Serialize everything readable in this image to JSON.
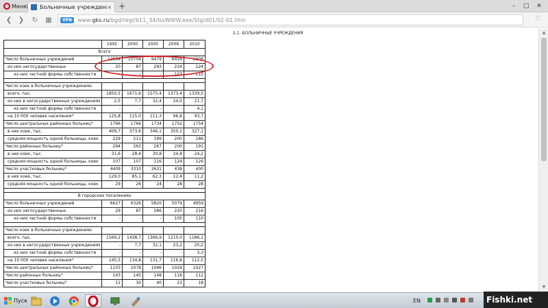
{
  "browser": {
    "menu_label": "Меню",
    "tab_title": "Больничные учреждения",
    "tab_close": "×",
    "newtab": "+",
    "win_min": "–",
    "win_max": "□",
    "win_close": "✕",
    "vpn_label": "VPN",
    "url_prefix": "www.",
    "url_host": "gks.ru",
    "url_path": "/bgd/regl/b11_34/IssWWW.exe/Stg/d01/02-01.htm"
  },
  "page": {
    "heading": "2.1. БОЛЬНИЧНЫЕ УЧРЕЖДЕНИЯ",
    "years": [
      "1995",
      "2000",
      "2005",
      "2009",
      "2010"
    ]
  },
  "rows": [
    {
      "section": "Всего"
    },
    {
      "label": "Число больничных учреждений",
      "indent": 0,
      "values": [
        "12064",
        "10704",
        "9479",
        "6454",
        "6308"
      ]
    },
    {
      "label": "из них негосударственных",
      "indent": 1,
      "values": [
        "20",
        "87",
        "293",
        "224",
        "224"
      ]
    },
    {
      "label": "из них частной формы собственности",
      "indent": 2,
      "values": [
        "-",
        "-",
        "-",
        "107",
        "115"
      ]
    },
    {
      "blank": true
    },
    {
      "label": "Число коек в больничных учреждениях:",
      "indent": 0,
      "values": [
        "",
        "",
        "",
        "",
        ""
      ]
    },
    {
      "label": "всего, тыс.",
      "indent": 1,
      "values": [
        "1850,5",
        "1671,6",
        "1575,4",
        "1373,4",
        "1339,5"
      ]
    },
    {
      "label": "из них в негосударственных учреждениях",
      "indent": 1,
      "values": [
        "2,5",
        "7,7",
        "32,4",
        "24,0",
        "21,7"
      ]
    },
    {
      "label": "из них частной формы собственности",
      "indent": 2,
      "values": [
        "-",
        "-",
        "-",
        "-",
        "4,1"
      ]
    },
    {
      "label": "на 10 000 человек населения¹⁾",
      "indent": 1,
      "values": [
        "125,8",
        "115,0",
        "111,3",
        "96,8",
        "93,7"
      ]
    },
    {
      "label": "Число центральных районных больниц²⁾",
      "indent": 0,
      "values": [
        "1766",
        "1766",
        "1734",
        "1752",
        "1754"
      ]
    },
    {
      "label": "в них коек, тыс.",
      "indent": 1,
      "values": [
        "409,7",
        "373,6",
        "346,1",
        "350,1",
        "327,1"
      ]
    },
    {
      "label": "средняя мощность одной больницы, коек",
      "indent": 1,
      "values": [
        "229",
        "211",
        "199",
        "200",
        "186"
      ]
    },
    {
      "label": "Число районных больниц²⁾",
      "indent": 0,
      "values": [
        "294",
        "263",
        "267",
        "200",
        "191"
      ]
    },
    {
      "label": "в них коек, тыс.",
      "indent": 1,
      "values": [
        "31,6",
        "28,4",
        "30,8",
        "24,8",
        "24,2"
      ]
    },
    {
      "label": "средняя мощность одной больницы, коек",
      "indent": 1,
      "values": [
        "107",
        "107",
        "116",
        "124",
        "126"
      ]
    },
    {
      "label": "Число участковых больниц²⁾",
      "indent": 0,
      "values": [
        "4409",
        "3310",
        "2631",
        "438",
        "400"
      ]
    },
    {
      "label": "в них коек, тыс.",
      "indent": 1,
      "values": [
        "129,0",
        "85,1",
        "62,3",
        "12,4",
        "11,2"
      ]
    },
    {
      "label": "средняя мощность одной больницы, коек",
      "indent": 1,
      "values": [
        "29",
        "26",
        "24",
        "28",
        "28"
      ]
    },
    {
      "blank": true
    },
    {
      "section": "В городских поселениях"
    },
    {
      "label": "Число больничных учреждений",
      "indent": 0,
      "values": [
        "6627",
        "6326",
        "5820",
        "5079",
        "4959"
      ]
    },
    {
      "label": "из них негосударственных",
      "indent": 1,
      "values": [
        "29",
        "87",
        "286",
        "220",
        "216"
      ]
    },
    {
      "label": "из них частной формы собственности",
      "indent": 2,
      "values": [
        "-",
        "-",
        "-",
        "105",
        "110"
      ]
    },
    {
      "blank": true
    },
    {
      "label": "Число коек в больничных учреждениях:",
      "indent": 0,
      "values": [
        "",
        "",
        "",
        "",
        ""
      ]
    },
    {
      "label": "всего, тыс.",
      "indent": 1,
      "values": [
        "1569,2",
        "1438,7",
        "1366,9",
        "1210,0",
        "1186,1"
      ]
    },
    {
      "label": "из них в негосударственных учреждениях",
      "indent": 1,
      "values": [
        "-",
        "7,7",
        "32,1",
        "23,2",
        "20,2"
      ]
    },
    {
      "label": "из них частной формы собственности",
      "indent": 2,
      "values": [
        "-",
        "-",
        "-",
        "-",
        "3,3"
      ]
    },
    {
      "label": "на 10 000 человек населения¹⁾",
      "indent": 1,
      "values": [
        "145,5",
        "134,8",
        "131,7",
        "116,8",
        "112,5"
      ]
    },
    {
      "label": "Число центральных районных больниц²⁾",
      "indent": 0,
      "values": [
        "1103",
        "1078",
        "1046",
        "1029",
        "1027"
      ]
    },
    {
      "label": "Число районных больниц²⁾",
      "indent": 0,
      "values": [
        "143",
        "145",
        "148",
        "116",
        "112"
      ]
    },
    {
      "label": "Число участковых больниц²⁾",
      "indent": 0,
      "values": [
        "11",
        "30",
        "40",
        "23",
        "18"
      ]
    }
  ],
  "taskbar": {
    "start_label": "Пуск",
    "lang": "EN",
    "watermark": "Fishki.net",
    "apps": [
      "explorer-icon",
      "media-player-icon",
      "chrome-icon",
      "opera-icon",
      "network-icon",
      "paint-icon"
    ]
  },
  "colors": {
    "highlight": "#d3262c",
    "opera": "#d0021b",
    "vpn": "#3c8fd8"
  }
}
